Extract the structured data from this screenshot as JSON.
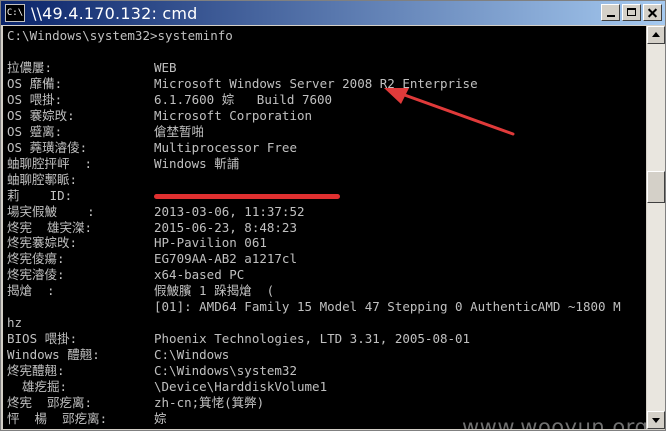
{
  "window": {
    "title": "\\\\49.4.170.132: cmd",
    "icon_label": "C:\\"
  },
  "console": {
    "command_line": "C:\\Windows\\system32>systeminfo",
    "rows": [
      {
        "label": "拉儂屢:",
        "value": "WEB"
      },
      {
        "label": "OS 靡備:",
        "value": "Microsoft Windows Server 2008 R2 Enterprise"
      },
      {
        "label": "OS 喂掛:",
        "value": "6.1.7600 婃   Build 7600"
      },
      {
        "label": "OS 褰婃攺:",
        "value": "Microsoft Corporation"
      },
      {
        "label": "OS 蹙离:",
        "value": "傖埜暂啪"
      },
      {
        "label": "OS 蕘璜濬倰:",
        "value": "Multiprocessor Free"
      },
      {
        "label": "蚰聊腔抨岼  :",
        "value": "Windows 斬誧"
      },
      {
        "label": "蚰聊腔鄟眽:",
        "value": ""
      },
      {
        "label": "莉    ID:",
        "value": "",
        "redacted": true
      },
      {
        "label": "場宎假鮍    :",
        "value": "2013-03-06, 11:37:52"
      },
      {
        "label": "炵宪  雄宎滐:",
        "value": "2015-06-23, 8:48:23"
      },
      {
        "label": "炵宪褰婃攺:",
        "value": "HP-Pavilion 061"
      },
      {
        "label": "炵宪倰瘍:",
        "value": "EG709AA-AB2 a1217cl"
      },
      {
        "label": "炵宪濬倰:",
        "value": "x64-based PC"
      },
      {
        "label": "揭熗  :",
        "value": "假鮍臏 1 跺揭熗  ("
      },
      {
        "label": "",
        "value": "[01]: AMD64 Family 15 Model 47 Stepping 0 AuthenticAMD ~1800 M"
      },
      {
        "label": "hz",
        "value": ""
      },
      {
        "label": "BIOS 喂掛:",
        "value": "Phoenix Technologies, LTD 3.31, 2005-08-01"
      },
      {
        "label": "Windows 醴翹:",
        "value": "C:\\Windows"
      },
      {
        "label": "炵宪醴翹:",
        "value": "C:\\Windows\\system32"
      },
      {
        "label": "  雄疙掘:",
        "value": "\\Device\\HarddiskVolume1"
      },
      {
        "label": "炵宪  郖疙离:",
        "value": "zh-cn;箕恅(箕弊)"
      },
      {
        "label": "怦  楊  郖疙离:",
        "value": "婃"
      }
    ]
  },
  "annotation": {
    "arrow_color": "#e03a3a",
    "redaction_color": "#e03030"
  },
  "watermark": {
    "text": "www.wooyun.org"
  }
}
